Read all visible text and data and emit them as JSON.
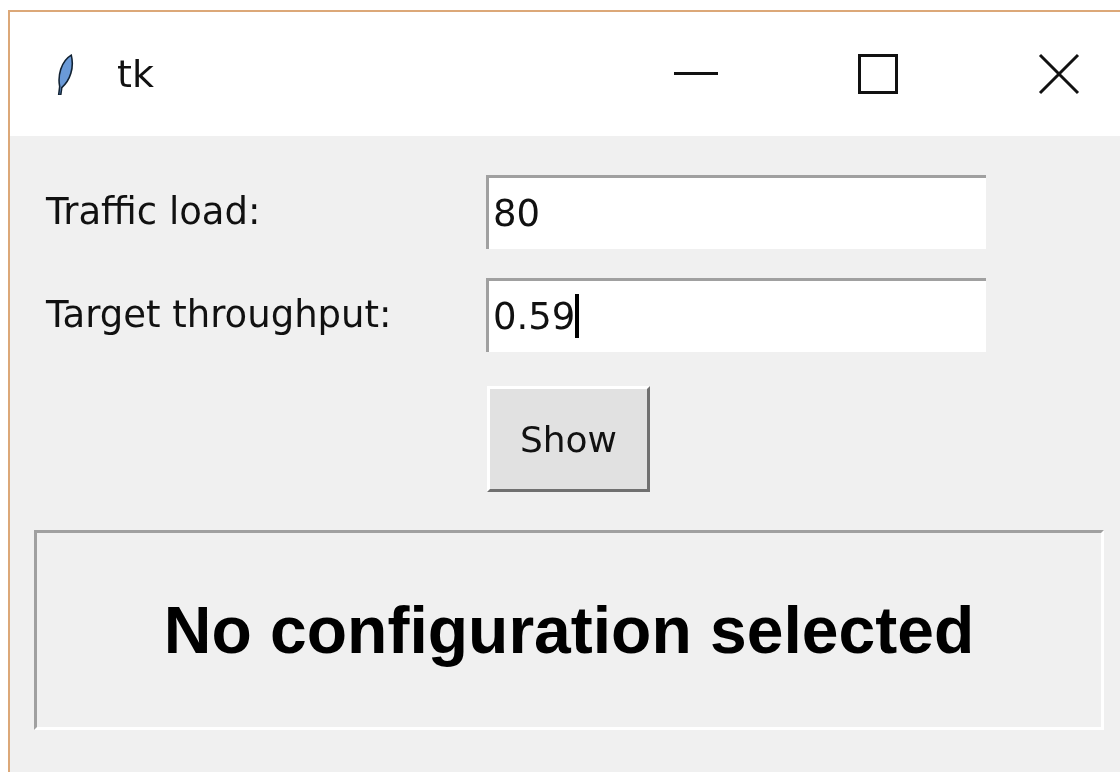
{
  "window": {
    "title": "tk"
  },
  "fields": [
    {
      "label": "Traffic load:",
      "value": "80",
      "focused": false
    },
    {
      "label": "Target throughput:",
      "value": "0.59",
      "focused": true
    }
  ],
  "button": {
    "label": "Show"
  },
  "result": {
    "text": "No configuration selected"
  }
}
